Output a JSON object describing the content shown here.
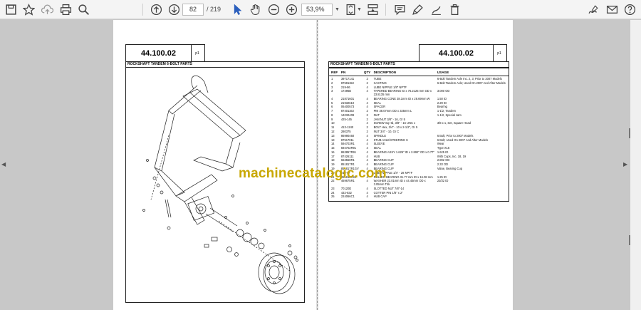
{
  "viewer": {
    "page_current": "82",
    "page_total": "/ 219",
    "zoom": "53,9%"
  },
  "icons": [
    "save-icon",
    "bookmark-icon",
    "upload-icon",
    "print-icon",
    "zoom-search-icon",
    "page-up-icon",
    "page-down-icon",
    "cursor-icon",
    "hand-icon",
    "zoom-out-icon",
    "zoom-in-icon",
    "fit-page-icon",
    "scroll-mode-icon",
    "comment-icon",
    "highlight-icon",
    "stamp-icon",
    "delete-icon",
    "sign-icon",
    "mail-icon",
    "help-icon"
  ],
  "left_page": {
    "doc_number": "44.100.02",
    "page_label": "p1",
    "section_title": "ROCKSHAFT TANDEM 6-BOLT PARTS"
  },
  "right_page": {
    "doc_number": "44.100.02",
    "page_label": "p1",
    "section_title": "ROCKSHAFT TANDEM 6-BOLT PARTS",
    "columns": [
      "REF",
      "PN",
      "QTY",
      "DESCRIPTION",
      "USAGE"
    ],
    "rows": [
      {
        "ref": "1",
        "pn": "39717141",
        "qty": "2",
        "desc": "TUBE",
        "use": "6-Bolt Tandem Axle Inc. 2, 3; Prior to 2007 Models"
      },
      {
        "ref": "2",
        "pn": "87591153",
        "qty": "2",
        "desc": "CASTING",
        "use": "6-Bolt Tandem Axle; Used On 2007 And After Models"
      },
      {
        "ref": "3",
        "pn": "219-86",
        "qty": "4",
        "desc": "LUBE NIPPLE 1/8\" NPTF",
        "use": ""
      },
      {
        "ref": "3",
        "pn": "17496D",
        "qty": "4",
        "desc": "TAPERED BEARING ID x 76.2125 mm OD x 23.8135 mm",
        "use": "3.000 OD"
      },
      {
        "ref": "4",
        "pn": "21871601",
        "qty": "4",
        "desc": "BEARING CONE 38.1mm ID x 28.69mm W",
        "use": "1.50 ID"
      },
      {
        "ref": "5",
        "pn": "21932610",
        "qty": "4",
        "desc": "SEAL",
        "use": "2.29 ID"
      },
      {
        "ref": "6",
        "pn": "06400573",
        "qty": "4",
        "desc": "SPACER",
        "use": "Bearing"
      },
      {
        "ref": "7",
        "pn": "87401163",
        "qty": "2",
        "desc": "PIN 38.07mm OD x 325mm L",
        "use": "1-1/2, Tandem"
      },
      {
        "ref": "8",
        "pn": "14032409",
        "qty": "2",
        "desc": "NUT",
        "use": "1-1/2, Special Jam"
      },
      {
        "ref": "9",
        "pn": "425-145",
        "qty": "2",
        "desc": "JAM NUT 3/8\" - 16, Gr 5",
        "use": ""
      },
      {
        "ref": "10",
        "pn": "",
        "qty": "4",
        "desc": "SCREW Sq Hd, 3/8\" - 16 UNC x",
        "use": "3/8 x 1, Set, Square Head"
      },
      {
        "ref": "11",
        "pn": "413-1240",
        "qty": "2",
        "desc": "BOLT Hex, 3/4\" - 10 x 2-1/2\", Gr 5",
        "use": ""
      },
      {
        "ref": "12",
        "pn": "280375",
        "qty": "2",
        "desc": "NUT 3/4\" - 10, Gr C",
        "use": ""
      },
      {
        "ref": "13",
        "pn": "86990460",
        "qty": "4",
        "desc": "SPINDLE",
        "use": "6 Bolt; Prior to 2007 Models"
      },
      {
        "ref": "13",
        "pn": "87517011",
        "qty": "4",
        "desc": "STUB AXLE/STEERING S",
        "use": "6 Bolt; Used On 2007 And After Models"
      },
      {
        "ref": "14",
        "pn": "594703R1",
        "qty": "4",
        "desc": "SLEEVE",
        "use": "Wear"
      },
      {
        "ref": "15",
        "pn": "594702R91",
        "qty": "4",
        "desc": "SEAL",
        "use": "Type X15"
      },
      {
        "ref": "16",
        "pn": "863857R91",
        "qty": "4",
        "desc": "BEARING ASSY 1.625\" ID x 2.892\" OD x 0.77\"",
        "use": "1.625 ID"
      },
      {
        "ref": "17",
        "pn": "87426111",
        "qty": "4",
        "desc": "HUB",
        "use": "With Cups, Inc. 18, 19"
      },
      {
        "ref": "18",
        "pn": "663558R1",
        "qty": "4",
        "desc": "BEARING CUP",
        "use": "2.892 OD"
      },
      {
        "ref": "19",
        "pn": "851817R1",
        "qty": "4",
        "desc": "BEARING CUP",
        "use": "2.33 OD"
      },
      {
        "ref": "19",
        "pn": "851817R1GV",
        "qty": "4",
        "desc": "BEARING CUP",
        "use": "Value, Bearing Cup"
      },
      {
        "ref": "20",
        "pn": "219-87",
        "qty": "4",
        "desc": "LUBE NIPPLE 1/4\" - 28 NPTF",
        "use": ""
      },
      {
        "ref": "21",
        "pn": "851818R91",
        "qty": "4",
        "desc": "ROLLER BEARING 31.77 mm ID x 16.08 mm",
        "use": "1.25 ID"
      },
      {
        "ref": "22",
        "pn": "469675R1",
        "qty": "4",
        "desc": "WASHER 23.01mm ID x 44.45mm OD x 3.05mm Thk",
        "use": "23/32 ID"
      },
      {
        "ref": "23",
        "pn": "70120D",
        "qty": "4",
        "desc": "SLOTTED NUT 7/8\"-14",
        "use": ""
      },
      {
        "ref": "24",
        "pn": "432-832",
        "qty": "4",
        "desc": "COTTER PIN 1/8\" x 2\"",
        "use": ""
      },
      {
        "ref": "25",
        "pn": "224066C1",
        "qty": "4",
        "desc": "HUB CAP",
        "use": ""
      }
    ]
  },
  "watermark": "machinecatalogic.com"
}
